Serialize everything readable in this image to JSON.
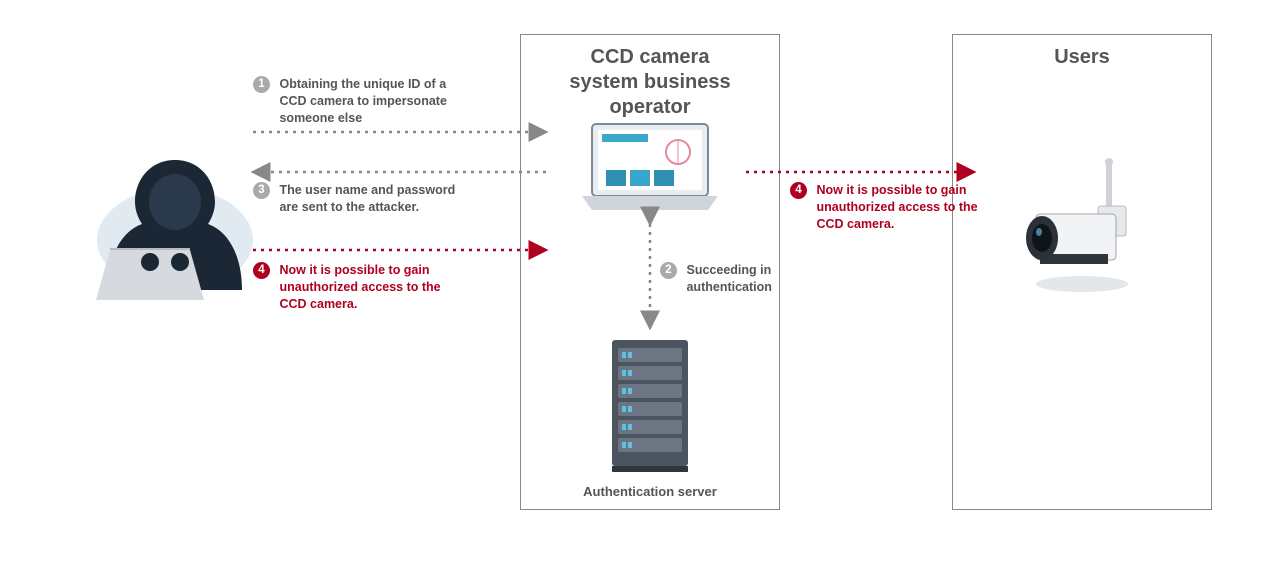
{
  "boxes": {
    "operator_title": "CCD camera\nsystem business\noperator",
    "users_title": "Users",
    "auth_server_caption": "Authentication server"
  },
  "steps": {
    "s1": "Obtaining the unique ID of a\nCCD camera to impersonate\nsomeone else",
    "s2": "Succeeding in authentication",
    "s3": "The user name and password\nare sent to the attacker.",
    "s4a": "Now it is possible to gain\nunauthorized access to the\nCCD camera.",
    "s4b": "Now it is possible to gain\nunauthorized access to the\nCCD camera."
  },
  "nums": {
    "n1": "1",
    "n2": "2",
    "n3": "3",
    "n4": "4"
  },
  "colors": {
    "grey": "#888888",
    "red": "#b00020"
  }
}
